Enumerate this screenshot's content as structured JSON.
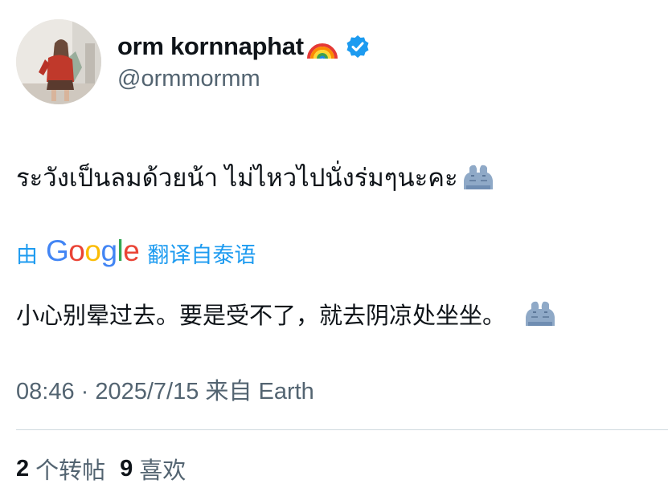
{
  "author": {
    "display_name": "orm kornnaphat",
    "handle": "@ormmormm",
    "name_emoji": "rainbow-emoji",
    "verified": true,
    "verified_color": "#1d9bf0"
  },
  "tweet": {
    "text": "ระวังเป็นลมด้วยน้า ไม่ไหวไปนั่งร่มๆนะคะ",
    "text_emoji": "moai-emoji"
  },
  "translation": {
    "prefix": "由",
    "provider_letters": [
      "G",
      "o",
      "o",
      "g",
      "l",
      "e"
    ],
    "suffix": "翻译自泰语",
    "text": "小心别晕过去。要是受不了，就去阴凉处坐坐。",
    "text_emoji": "moai-emoji",
    "link_color": "#1d9bf0"
  },
  "meta": {
    "timestamp": "08:46 · 2025/7/15 来自 Earth"
  },
  "stats": {
    "retweets_count": "2",
    "retweets_label": "个转帖",
    "likes_count": "9",
    "likes_label": "喜欢"
  }
}
